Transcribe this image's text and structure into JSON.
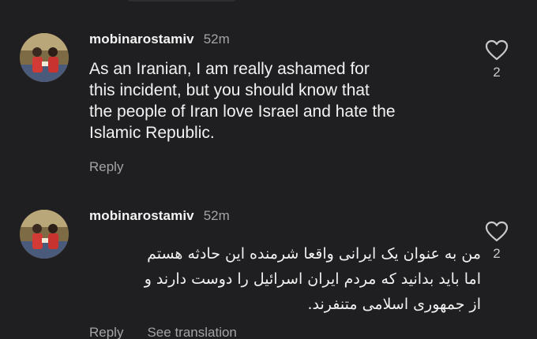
{
  "comments": [
    {
      "username": "mobinarostamiv",
      "time": "52m",
      "text_lines": [
        "As an Iranian, I am really ashamed for",
        "this incident, but you should know that",
        "the people of Iran love Israel and hate the",
        "Islamic Republic."
      ],
      "like_count": "2",
      "reply_label": "Reply"
    },
    {
      "username": "mobinarostamiv",
      "time": "52m",
      "text_lines": [
        "من به عنوان یک ایرانی واقعا شرمنده این حادثه هستم",
        "اما باید بدانید که مردم ایران اسرائیل را دوست دارند و",
        "از جمهوری اسلامی متنفرند."
      ],
      "like_count": "2",
      "reply_label": "Reply",
      "translate_label": "See translation"
    }
  ],
  "colors": {
    "background": "#1f1f21",
    "text": "#f2f2f2",
    "muted": "#a3a3a8"
  },
  "icons": {
    "like": "heart-outline-icon"
  }
}
